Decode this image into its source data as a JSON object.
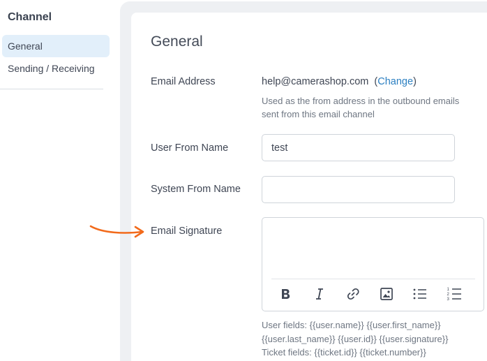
{
  "sidebar": {
    "title": "Channel",
    "items": [
      {
        "label": "General",
        "active": true
      },
      {
        "label": "Sending / Receiving",
        "active": false
      }
    ]
  },
  "main": {
    "title": "General",
    "email_address": {
      "label": "Email Address",
      "value": "help@camerashop.com",
      "open_paren": "(",
      "change_label": "Change",
      "close_paren": ")",
      "help": "Used as the from address in the outbound emails sent from this email channel"
    },
    "user_from_name": {
      "label": "User From Name",
      "value": "test",
      "placeholder": ""
    },
    "system_from_name": {
      "label": "System From Name",
      "value": "",
      "placeholder": ""
    },
    "email_signature": {
      "label": "Email Signature",
      "toolbar": [
        "bold-icon",
        "italic-icon",
        "link-icon",
        "image-icon",
        "bullet-list-icon",
        "numbered-list-icon"
      ],
      "placeholders_line1": "User fields: {{user.name}} {{user.first_name}}",
      "placeholders_line2": "{{user.last_name}} {{user.id}} {{user.signature}}",
      "placeholders_line3": "Ticket fields: {{ticket.id}} {{ticket.number}}"
    }
  },
  "colors": {
    "accent": "#2b7fc1",
    "active_nav_bg": "#e2effa",
    "annotation_arrow": "#f26a1b"
  }
}
